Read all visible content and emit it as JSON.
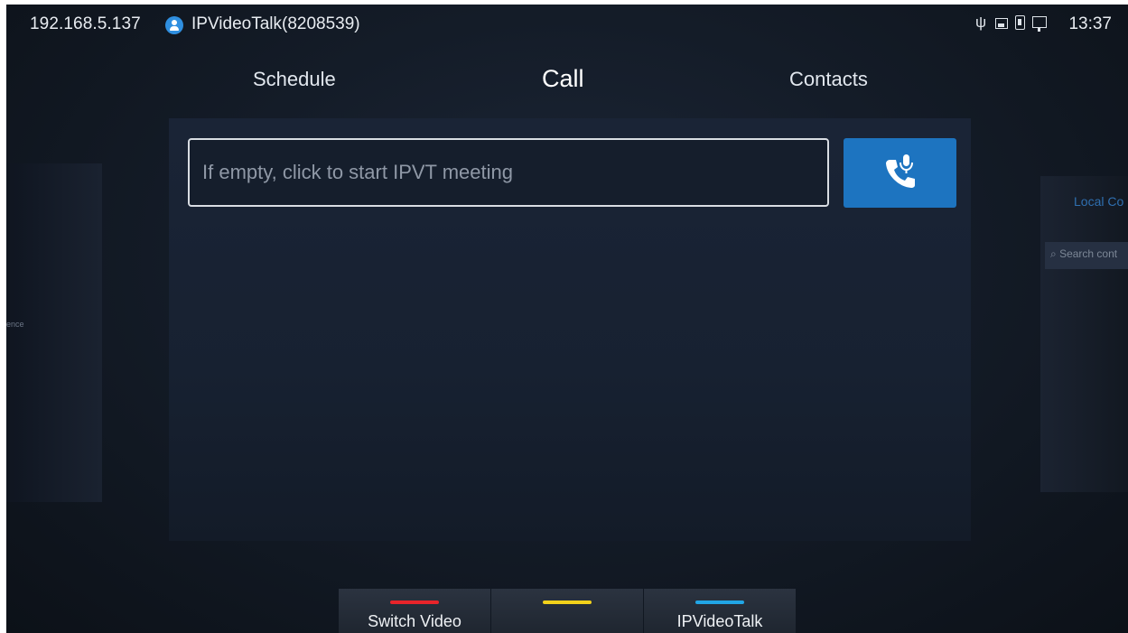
{
  "status_bar": {
    "ip": "192.168.5.137",
    "account": "IPVideoTalk(8208539)",
    "time": "13:37",
    "icons": [
      "usb-icon",
      "image-icon",
      "sd-card-icon",
      "display-icon"
    ]
  },
  "tabs": [
    {
      "label": "Schedule"
    },
    {
      "label": "Call",
      "active": true
    },
    {
      "label": "Contacts"
    }
  ],
  "dial": {
    "placeholder": "If empty, click to start IPVT meeting",
    "button_icon": "phone-mic-icon"
  },
  "side_panels": {
    "left_hint": "ence",
    "right_title": "Local Co",
    "right_search": "Search cont"
  },
  "softkeys": [
    {
      "label": "Switch Video",
      "color": "#e8242a"
    },
    {
      "label": "",
      "color": "#f3d21b"
    },
    {
      "label": "IPVideoTalk",
      "color": "#21a6e6"
    }
  ],
  "colors": {
    "accent": "#1d74c0",
    "background": "#141c28"
  }
}
